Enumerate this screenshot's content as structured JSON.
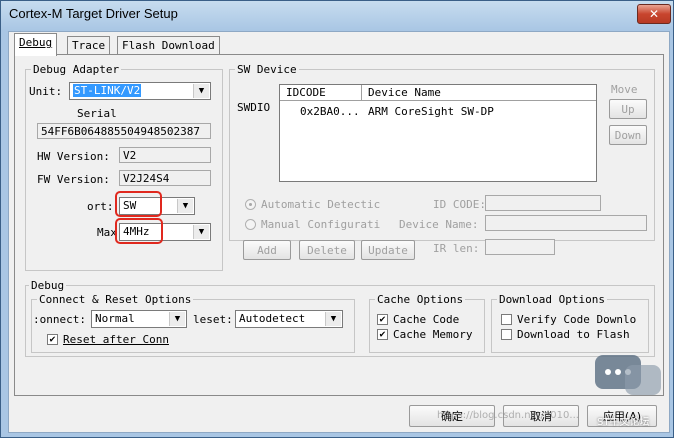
{
  "window": {
    "title": "Cortex-M Target Driver Setup",
    "close_glyph": "✕"
  },
  "tabs": [
    {
      "label": "Debug",
      "active": true
    },
    {
      "label": "Trace",
      "active": false
    },
    {
      "label": "Flash Download",
      "active": false
    }
  ],
  "debug_adapter": {
    "group_label": "Debug Adapter",
    "unit_label": "Unit:",
    "unit_value": "ST-LINK/V2",
    "serial_label": "Serial",
    "serial_value": "54FF6B064885504948502387",
    "hw_label": "HW Version:",
    "hw_value": "V2",
    "fw_label": "FW Version:",
    "fw_value": "V2J24S4",
    "port_label": "ort:",
    "port_value": "SW",
    "max_label": "Max",
    "max_value": "4MHz"
  },
  "sw_device": {
    "group_label": "SW Device",
    "side_label": "SWDIO",
    "columns": [
      "IDCODE",
      "Device Name"
    ],
    "rows": [
      {
        "idcode": "0x2BA0...",
        "device": "ARM CoreSight SW-DP"
      }
    ],
    "move_label": "Move",
    "up_label": "Up",
    "down_label": "Down",
    "auto_detect_label": "Automatic Detectic",
    "manual_config_label": "Manual Configurati",
    "id_code_label": "ID CODE:",
    "device_name_label": "Device Name:",
    "ir_len_label": "IR len:",
    "add_label": "Add",
    "delete_label": "Delete",
    "update_label": "Update"
  },
  "debug": {
    "group_label": "Debug",
    "connect_reset": {
      "group_label": "Connect & Reset Options",
      "connect_label": ":onnect:",
      "connect_value": "Normal",
      "reset_label": "leset:",
      "reset_value": "Autodetect",
      "reset_after_label": "Reset after Conn",
      "reset_after_checked": true
    },
    "cache": {
      "group_label": "Cache Options",
      "cache_code_label": "Cache Code",
      "cache_code_checked": true,
      "cache_memory_label": "Cache Memory",
      "cache_memory_checked": true
    },
    "download": {
      "group_label": "Download Options",
      "verify_label": "Verify Code Downlo",
      "verify_checked": false,
      "flash_label": "Download to Flash",
      "flash_checked": false
    }
  },
  "footer": {
    "ok_label": "确定",
    "cancel_label": "取消",
    "apply_label": "应用(A)",
    "watermark": "https://blog.csdn.net/u010..."
  },
  "overlay": {
    "badge_text": "ST中文论坛"
  },
  "check_glyph": "✔",
  "arrow_glyph": "▼"
}
